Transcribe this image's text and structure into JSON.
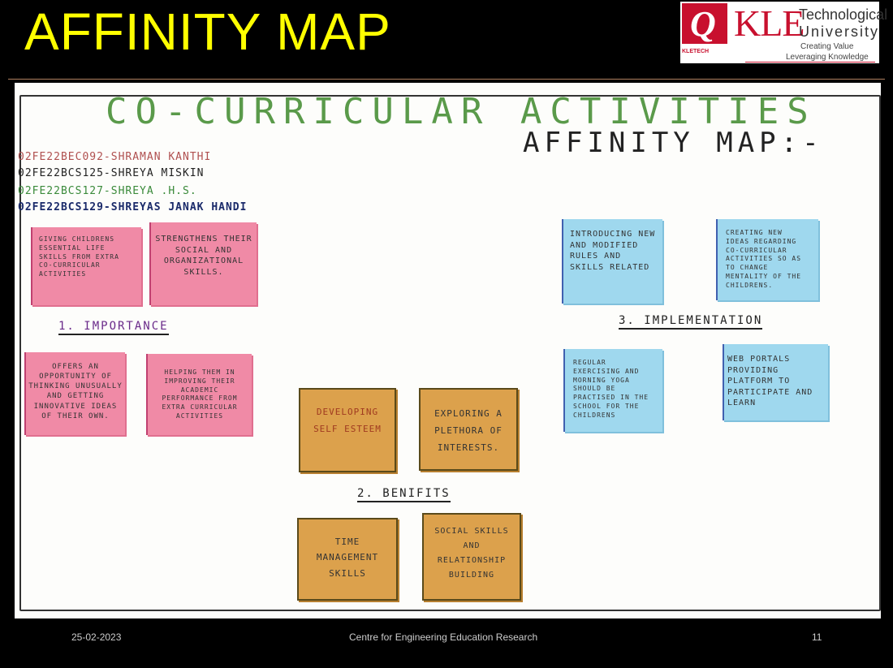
{
  "slide": {
    "title": "AFFINITY MAP",
    "logo": {
      "mark_letter": "Q",
      "mark_sub": "KLETECH",
      "name": "KLE",
      "line1": "Technological",
      "line2": "University",
      "tagline1": "Creating Value",
      "tagline2": "Leveraging Knowledge"
    }
  },
  "poster": {
    "title": "CO-CURRICULAR ACTIVITIES",
    "subtitle": "AFFINITY MAP:-",
    "members": [
      "02FE22BEC092-SHRAMAN KANTHI",
      "02FE22BCS125-SHREYA MISKIN",
      "02FE22BCS127-SHREYA .H.S.",
      "02FE22BCS129-SHREYAS JANAK HANDI"
    ],
    "importance": {
      "heading": "1. IMPORTANCE",
      "notes": [
        "GIVING CHILDRENS ESSENTIAL LIFE SKILLS FROM EXTRA CO-CURRICULAR ACTIVITIES",
        "STRENGTHENS THEIR SOCIAL AND ORGANIZATIONAL SKILLS.",
        "OFFERS AN OPPORTUNITY OF THINKING UNUSUALLY AND GETTING INNOVATIVE IDEAS OF THEIR OWN.",
        "HELPING THEM IN IMPROVING THEIR ACADEMIC PERFORMANCE FROM EXTRA CURRICULAR ACTIVITIES"
      ]
    },
    "benefits": {
      "heading": "2. BENIFITS",
      "notes": [
        "DEVELOPING SELF ESTEEM",
        "EXPLORING A PLETHORA OF INTERESTS.",
        "TIME MANAGEMENT SKILLS",
        "SOCIAL SKILLS AND RELATIONSHIP BUILDING"
      ]
    },
    "implementation": {
      "heading": "3. IMPLEMENTATION",
      "notes": [
        "INTRODUCING NEW AND MODIFIED RULES AND SKILLS RELATED",
        "CREATING NEW IDEAS REGARDING CO-CURRICULAR ACTIVITIES SO AS TO CHANGE MENTALITY OF THE CHILDRENS.",
        "REGULAR EXERCISING AND MORNING YOGA SHOULD BE PRACTISED IN THE SCHOOL FOR THE CHILDRENS",
        "WEB PORTALS PROVIDING PLATFORM TO PARTICIPATE AND LEARN"
      ]
    }
  },
  "footer": {
    "date": "25-02-2023",
    "center": "Centre for Engineering Education Research",
    "page": "11"
  },
  "colors": {
    "title": "#ffff00",
    "background": "#000000",
    "pink_note": "#f08aa6",
    "blue_note": "#9fd8ee",
    "orange_note": "#dca14c",
    "brand_red": "#c8102e"
  }
}
